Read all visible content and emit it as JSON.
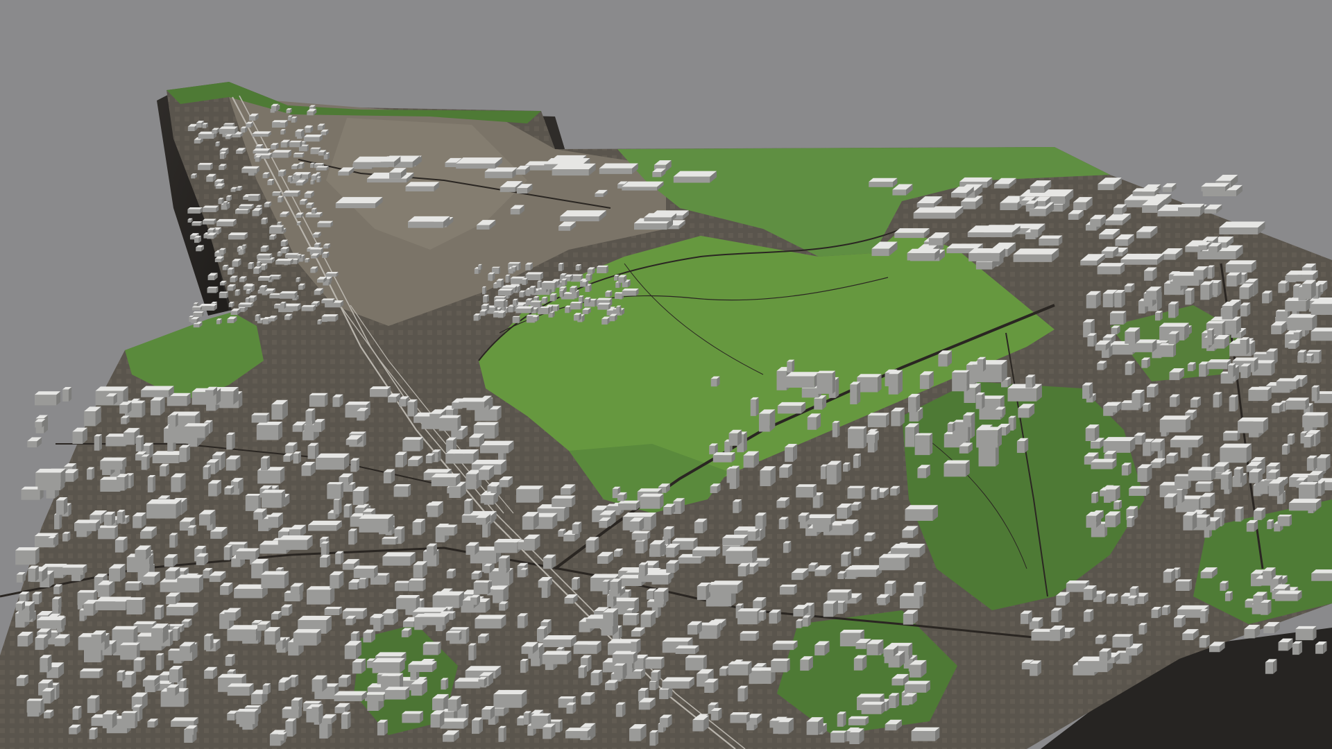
{
  "scene": {
    "kind": "3d-city-model",
    "background_color": "#8a8a8c",
    "colors": {
      "ground_urban": "#5a554d",
      "ground_light": "#6e685f",
      "ground_industrial": "#7b7468",
      "park_green": "#5f8f42",
      "forest_green": "#4e7a35",
      "dark_green": "#2f4a26",
      "slab_side": "#2c2a27",
      "building_top": "#e6e6e4",
      "building_side": "#9a9a98",
      "road": "#2a2622",
      "rail": "#b8b4ac"
    },
    "labels": []
  }
}
